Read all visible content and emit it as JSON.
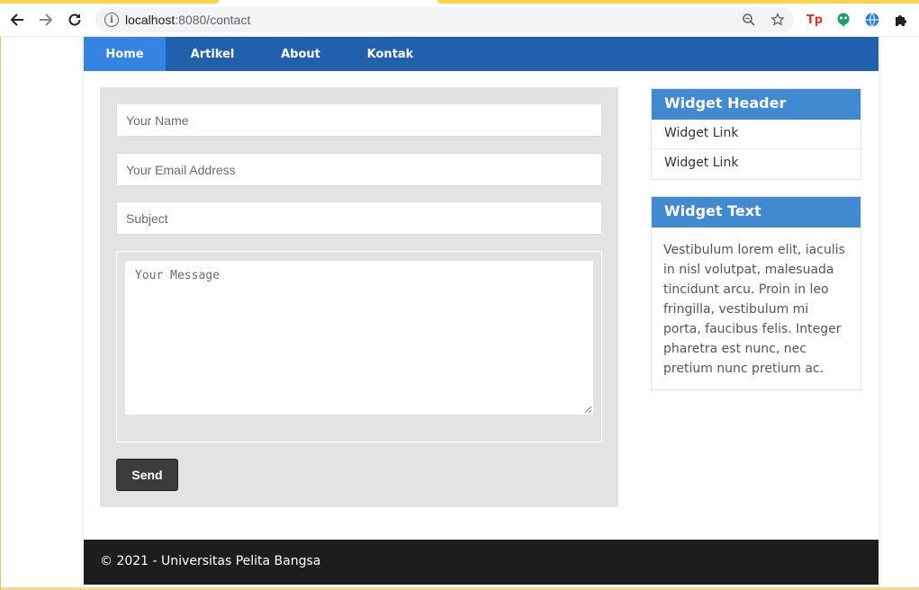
{
  "browser": {
    "url_host": "localhost",
    "url_path": ":8080/contact",
    "back_icon": "arrow-left",
    "forward_icon": "arrow-right",
    "reload_icon": "reload",
    "accent_color": "#f9d34a",
    "extensions": [
      {
        "name": "tp-extension-icon",
        "glyph": "Tp",
        "color": "#e0342b"
      },
      {
        "name": "green-robot-extension-icon",
        "glyph": "●",
        "color": "#1e9e6a"
      },
      {
        "name": "globe-extension-icon",
        "glyph": "●",
        "color": "#2a7fd4"
      },
      {
        "name": "puzzle-extensions-icon",
        "glyph": "✚",
        "color": "#202124"
      }
    ]
  },
  "nav": {
    "items": [
      {
        "label": "Home",
        "active": true
      },
      {
        "label": "Artikel",
        "active": false
      },
      {
        "label": "About",
        "active": false
      },
      {
        "label": "Kontak",
        "active": false
      }
    ],
    "color": "#2160ad",
    "active_color": "#3584e4"
  },
  "form": {
    "name_placeholder": "Your Name",
    "email_placeholder": "Your Email Address",
    "subject_placeholder": "Subject",
    "message_placeholder": "Your Message",
    "send_label": "Send"
  },
  "sidebar": {
    "links_widget": {
      "header": "Widget Header",
      "links": [
        "Widget Link",
        "Widget Link"
      ]
    },
    "text_widget": {
      "header": "Widget Text",
      "body": "Vestibulum lorem elit, iaculis in nisl volutpat, malesuada tincidunt arcu. Proin in leo fringilla, vestibulum mi porta, faucibus felis. Integer pharetra est nunc, nec pretium nunc pretium ac."
    },
    "header_color": "#4189d1"
  },
  "footer": {
    "text": "© 2021 - Universitas Pelita Bangsa",
    "color": "#1d1d1d"
  }
}
